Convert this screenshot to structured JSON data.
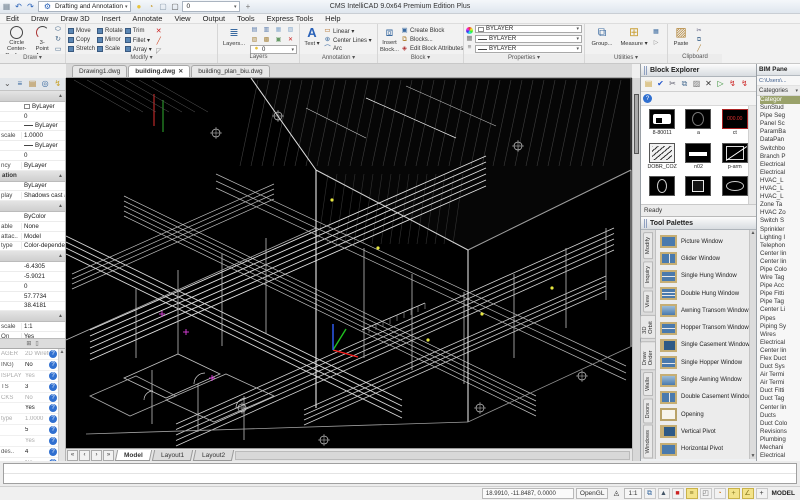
{
  "titlebar": {
    "title": "CMS IntelliCAD 9.0x64 Premium Edition Plus",
    "workspace": "Drafting and Annotation",
    "quick_layer_value": "0",
    "quick_icons": [
      {
        "name": "table-icon",
        "glyph": "▦",
        "color": "#7a8a99"
      },
      {
        "name": "undo-icon",
        "glyph": "↶",
        "color": "#2a62b8"
      },
      {
        "name": "redo-icon",
        "glyph": "↷",
        "color": "#2a62b8"
      }
    ],
    "layer_icons": [
      {
        "name": "bulb-on-icon",
        "glyph": "●",
        "color": "#e8c33a"
      },
      {
        "name": "freeze-icon",
        "glyph": "◔",
        "color": "#caa23a"
      },
      {
        "name": "lock-icon",
        "glyph": "▢",
        "color": "#8898a8"
      },
      {
        "name": "layer-color-icon",
        "glyph": "▢",
        "color": "#555555"
      }
    ]
  },
  "menus": [
    "Edit",
    "Draw",
    "Draw 3D",
    "Insert",
    "Annotate",
    "View",
    "Output",
    "Tools",
    "Express Tools",
    "Help"
  ],
  "ribbon": {
    "draw": {
      "label": "Draw ▾",
      "circle": "Circle Center-Radius ▾",
      "arc": "3-Point Arc ▾",
      "minis": [
        {
          "name": "ellipse-icon",
          "glyph": "⬭",
          "color": "#446688"
        },
        {
          "name": "revcloud-icon",
          "glyph": "↻",
          "color": "#446688"
        },
        {
          "name": "rectangle-icon",
          "glyph": "▭",
          "color": "#446688"
        }
      ]
    },
    "modify": {
      "label": "Modify ▾",
      "col1": [
        "Move",
        "Copy",
        "Stretch"
      ],
      "col2": [
        "Rotate",
        "Mirror",
        "Scale"
      ],
      "col3": [
        "Trim",
        "Fillet ▾",
        "Array ▾"
      ],
      "col4": [
        {
          "name": "erase-icon",
          "glyph": "✕",
          "color": "#cc2222"
        },
        {
          "name": "edit-icon",
          "glyph": "╱",
          "color": "#cc4422"
        },
        {
          "name": "chamfer-icon",
          "glyph": "◸",
          "color": "#888888"
        }
      ]
    },
    "layers": {
      "label": "Layers",
      "button": "Layers...",
      "layer_value": "0",
      "minis": [
        {
          "name": "layer-on-icon",
          "glyph": "▤",
          "color": "#5577aa"
        },
        {
          "name": "layer-off-icon",
          "glyph": "▥",
          "color": "#5577aa"
        },
        {
          "name": "layer-freeze-icon",
          "glyph": "▦",
          "color": "#88aacc"
        },
        {
          "name": "layer-thaw-icon",
          "glyph": "▧",
          "color": "#88aacc"
        },
        {
          "name": "layer-lock-icon",
          "glyph": "▨",
          "color": "#aa8844"
        },
        {
          "name": "layer-unlock-icon",
          "glyph": "▩",
          "color": "#aa8844"
        },
        {
          "name": "layer-match-icon",
          "glyph": "▣",
          "color": "#669966"
        },
        {
          "name": "layer-delete-icon",
          "glyph": "✕",
          "color": "#cc2222"
        }
      ]
    },
    "annotation": {
      "label": "Annotation ▾",
      "text": "Text ▾",
      "items": [
        {
          "label": "Linear ▾",
          "name": "linear-dim-icon",
          "glyph": "▭",
          "color": "#b06820"
        },
        {
          "label": "Center Lines ▾",
          "name": "centerlines-icon",
          "glyph": "⊕",
          "color": "#3a6aa0"
        },
        {
          "label": "Arc",
          "name": "arc-leader-icon",
          "glyph": "⌒",
          "color": "#3a6aa0"
        }
      ]
    },
    "block": {
      "label": "Block ▾",
      "insert": "Insert Block...",
      "items": [
        {
          "label": "Create Block",
          "name": "create-block-icon",
          "glyph": "▣",
          "color": "#3a6aa0"
        },
        {
          "label": "Blocks...",
          "name": "blocks-icon",
          "glyph": "⧉",
          "color": "#b08030"
        },
        {
          "label": "Edit Block Attributes",
          "name": "edit-attributes-icon",
          "glyph": "◈",
          "color": "#b03030"
        }
      ]
    },
    "properties": {
      "label": "Properties ▾",
      "dropdowns": [
        "BYLAYER",
        "BYLAYER",
        "BYLAYER"
      ]
    },
    "utilities": {
      "label": "Utilities ▾",
      "group": "Group...",
      "measure": "Measure ▾"
    },
    "clipboard": {
      "label": "Clipboard",
      "paste": "Paste",
      "minis": [
        {
          "name": "cut-icon",
          "glyph": "✂",
          "color": "#555577"
        },
        {
          "name": "copy-icon",
          "glyph": "⧉",
          "color": "#557799"
        },
        {
          "name": "matchprops-icon",
          "glyph": "╱",
          "color": "#aa7722"
        }
      ]
    }
  },
  "doc_tabs": [
    {
      "label": "Drawing1.dwg",
      "active": false
    },
    {
      "label": "building.dwg",
      "active": true
    },
    {
      "label": "building_plan_biu.dwg",
      "active": false
    }
  ],
  "properties_panel": {
    "toolbar_icons": [
      {
        "name": "selection-dropdown-icon",
        "glyph": "⌄",
        "color": "#555555"
      },
      {
        "name": "quick-select-icon",
        "glyph": "≡",
        "color": "#3a6aa0"
      },
      {
        "name": "object-icon",
        "glyph": "▤",
        "color": "#b08030"
      },
      {
        "name": "search-icon",
        "glyph": "◎",
        "color": "#3a6aa0"
      },
      {
        "name": "flash-icon",
        "glyph": "↯",
        "color": "#c9a227"
      }
    ],
    "rows": [
      {
        "kind": "header",
        "label": "",
        "value": ""
      },
      {
        "kind": "row",
        "label": "",
        "value": "ByLayer",
        "icon": "swatch"
      },
      {
        "kind": "row",
        "label": "",
        "value": "0"
      },
      {
        "kind": "row",
        "label": "",
        "value": "ByLayer",
        "icon": "hline"
      },
      {
        "kind": "row",
        "label": "scale",
        "value": "1.0000"
      },
      {
        "kind": "row",
        "label": "",
        "value": "ByLayer",
        "icon": "hline"
      },
      {
        "kind": "row",
        "label": "",
        "value": "0"
      },
      {
        "kind": "row",
        "label": "ncy",
        "value": "ByLayer"
      },
      {
        "kind": "header",
        "label": "ation",
        "value": ""
      },
      {
        "kind": "row",
        "label": "",
        "value": "ByLayer"
      },
      {
        "kind": "row",
        "label": "play",
        "value": "Shadows cast a.."
      },
      {
        "kind": "header",
        "label": "",
        "value": ""
      },
      {
        "kind": "row",
        "label": "",
        "value": "ByColor"
      },
      {
        "kind": "row",
        "label": "able",
        "value": "None"
      },
      {
        "kind": "row",
        "label": "attac..",
        "value": "Model"
      },
      {
        "kind": "row",
        "label": "type",
        "value": "Color-dependen..."
      },
      {
        "kind": "header",
        "label": "",
        "value": ""
      },
      {
        "kind": "row",
        "label": "",
        "value": "-6.4305"
      },
      {
        "kind": "row",
        "label": "",
        "value": "-5.9021"
      },
      {
        "kind": "row",
        "label": "",
        "value": "0"
      },
      {
        "kind": "row",
        "label": "",
        "value": "57.7734"
      },
      {
        "kind": "row",
        "label": "",
        "value": "38.4181"
      },
      {
        "kind": "header",
        "label": "",
        "value": ""
      },
      {
        "kind": "row",
        "label": "scale",
        "value": "1:1"
      },
      {
        "kind": "row",
        "label": "On",
        "value": "Yes"
      }
    ]
  },
  "sysvar_panel": {
    "rows": [
      {
        "label": "AGER",
        "value": "2D Wirefr",
        "dim": true
      },
      {
        "label": "ING)",
        "value": "No",
        "dim": false
      },
      {
        "label": "ISPLAY",
        "value": "Yes",
        "dim": true
      },
      {
        "label": "TS",
        "value": "3",
        "dim": false
      },
      {
        "label": "CKS",
        "value": "No",
        "dim": true
      },
      {
        "label": "",
        "value": "Yes",
        "dim": false
      },
      {
        "label": "type",
        "value": "1.0000",
        "dim": true
      },
      {
        "label": "",
        "value": "5",
        "dim": false
      },
      {
        "label": "",
        "value": "Yes",
        "dim": true
      },
      {
        "label": "des..",
        "value": "4",
        "dim": false
      },
      {
        "label": "",
        "value": "No",
        "dim": true
      },
      {
        "label": "",
        "value": "",
        "dim": true
      }
    ]
  },
  "block_explorer": {
    "title": "Block Explorer",
    "status": "Ready",
    "toolbar_icons": [
      {
        "name": "new-block-icon",
        "glyph": "▤",
        "color": "#caa23a"
      },
      {
        "name": "confirm-icon",
        "glyph": "✔",
        "color": "#2255cc"
      },
      {
        "name": "cut-icon",
        "glyph": "✂",
        "color": "#556"
      },
      {
        "name": "copy-icon",
        "glyph": "⧉",
        "color": "#557799"
      },
      {
        "name": "paste-icon",
        "glyph": "▨",
        "color": "#777777"
      },
      {
        "name": "delete-icon",
        "glyph": "✕",
        "color": "#333333"
      },
      {
        "name": "new-drawing-icon",
        "glyph": "▷",
        "color": "#2a8a2a"
      },
      {
        "name": "sync-icon",
        "glyph": "↯",
        "color": "#cc2222"
      },
      {
        "name": "regen-icon",
        "glyph": "↯",
        "color": "#cc2222"
      }
    ],
    "help_icon": "?",
    "blocks": [
      {
        "name": "8-80011",
        "variant": "plate",
        "thumb_text": ""
      },
      {
        "name": "a",
        "variant": "circle",
        "thumb_text": ""
      },
      {
        "name": "ct",
        "variant": "ct",
        "thumb_text": "000.00"
      },
      {
        "name": "DOBR_COZ",
        "variant": "sketch",
        "thumb_text": ""
      },
      {
        "name": "n02",
        "variant": "hbar",
        "thumb_text": ""
      },
      {
        "name": "p-arm",
        "variant": "diag",
        "thumb_text": ""
      },
      {
        "name": "",
        "variant": "oval",
        "thumb_text": ""
      },
      {
        "name": "",
        "variant": "square",
        "thumb_text": ""
      },
      {
        "name": "",
        "variant": "ellipse",
        "thumb_text": ""
      }
    ]
  },
  "tool_palettes": {
    "title": "Tool Palettes",
    "tabs": [
      "Modify",
      "Inquiry",
      "View",
      "3D Orbit",
      "Draw Order",
      "Walls",
      "Doors",
      "Windows"
    ],
    "items": [
      {
        "label": "Picture Window",
        "variant": "plain"
      },
      {
        "label": "Glider Window",
        "variant": "vsplit"
      },
      {
        "label": "Single Hung Window",
        "variant": "hsplit"
      },
      {
        "label": "Double Hung Window",
        "variant": "hsplit2"
      },
      {
        "label": "Awning Transom Window",
        "variant": "light"
      },
      {
        "label": "Hopper Transom Window",
        "variant": "hsplit"
      },
      {
        "label": "Single Casement Window",
        "variant": "door"
      },
      {
        "label": "Single Hopper Window",
        "variant": "hsplit"
      },
      {
        "label": "Single Awning Window",
        "variant": "light"
      },
      {
        "label": "Double Casement Window",
        "variant": "vsplit"
      },
      {
        "label": "Opening",
        "variant": "opening"
      },
      {
        "label": "Vertical Pivot",
        "variant": "door"
      },
      {
        "label": "Horizontal Pivot",
        "variant": "plain"
      }
    ]
  },
  "bim_pane": {
    "title": "BIM Pane",
    "path": "C:\\Users\\...",
    "categories_label": "Categories",
    "items": [
      {
        "label": "Categor",
        "active": true
      },
      {
        "label": "SunStud",
        "active": false
      },
      {
        "label": "Pipe Seg",
        "active": false
      },
      {
        "label": "Panel Sc",
        "active": false
      },
      {
        "label": "ParamBa",
        "active": false
      },
      {
        "label": "DataPan",
        "active": false
      },
      {
        "label": "Switchbo",
        "active": false
      },
      {
        "label": "Branch P",
        "active": false
      },
      {
        "label": "Electrical",
        "active": false
      },
      {
        "label": "Electrical",
        "active": false
      },
      {
        "label": "HVAC_L",
        "active": false
      },
      {
        "label": "HVAC_L",
        "active": false
      },
      {
        "label": "HVAC_L",
        "active": false
      },
      {
        "label": "Zone Ta",
        "active": false
      },
      {
        "label": "HVAC Zo",
        "active": false
      },
      {
        "label": "Switch S",
        "active": false
      },
      {
        "label": "Sprinkler",
        "active": false
      },
      {
        "label": "Lighting I",
        "active": false
      },
      {
        "label": "Telephon",
        "active": false
      },
      {
        "label": "Center lin",
        "active": false
      },
      {
        "label": "Center lin",
        "active": false
      },
      {
        "label": "Pipe Colo",
        "active": false
      },
      {
        "label": "Wire Tag",
        "active": false
      },
      {
        "label": "Pipe Acc",
        "active": false
      },
      {
        "label": "Pipe Fitti",
        "active": false
      },
      {
        "label": "Pipe Tag",
        "active": false
      },
      {
        "label": "Center Li",
        "active": false
      },
      {
        "label": "Pipes",
        "active": false
      },
      {
        "label": "Piping Sy",
        "active": false
      },
      {
        "label": "Wires",
        "active": false
      },
      {
        "label": "Electrical",
        "active": false
      },
      {
        "label": "Center lin",
        "active": false
      },
      {
        "label": "Flex Duct",
        "active": false
      },
      {
        "label": "Duct Sys",
        "active": false
      },
      {
        "label": "Air Termi",
        "active": false
      },
      {
        "label": "Air Termi",
        "active": false
      },
      {
        "label": "Duct Fitti",
        "active": false
      },
      {
        "label": "Duct Tag",
        "active": false
      },
      {
        "label": "Center lin",
        "active": false
      },
      {
        "label": "Ducts",
        "active": false
      },
      {
        "label": "Duct Colo",
        "active": false
      },
      {
        "label": "Revisions",
        "active": false
      },
      {
        "label": "Plumbing",
        "active": false
      },
      {
        "label": "Mechani",
        "active": false
      },
      {
        "label": "Electrical",
        "active": false
      }
    ]
  },
  "model_tabs": {
    "nav": [
      "«",
      "‹",
      "›",
      "»"
    ],
    "tabs": [
      {
        "label": "Model",
        "active": true
      },
      {
        "label": "Layout1",
        "active": false
      },
      {
        "label": "Layout2",
        "active": false
      }
    ]
  },
  "statusbar": {
    "coords": "18.9910, -11.8487, 0.0000",
    "renderer": "OpenGL",
    "ruler_glyph": "◬",
    "scale": "1:1",
    "mode": "MODEL",
    "icons": [
      {
        "name": "viewport-icon",
        "glyph": "⧉",
        "color": "#3a6aa0",
        "on": false
      },
      {
        "name": "annotation-monitor-icon",
        "glyph": "▲",
        "color": "#445566",
        "on": false
      },
      {
        "name": "record-macro-icon",
        "glyph": "■",
        "color": "#cc2222",
        "on": false
      },
      {
        "name": "lineweight-icon",
        "glyph": "≡",
        "color": "#8a7a22",
        "on": true
      },
      {
        "name": "ucs-icon",
        "glyph": "◰",
        "color": "#666666",
        "on": false
      },
      {
        "name": "time-icon",
        "glyph": "◔",
        "color": "#d07820",
        "on": false
      },
      {
        "name": "snap-cross-icon",
        "glyph": "+",
        "color": "#8a7a22",
        "on": true
      },
      {
        "name": "angle-snap-icon",
        "glyph": "∠",
        "color": "#8a7a22",
        "on": true
      },
      {
        "name": "crosshair-icon",
        "glyph": "+",
        "color": "#333333",
        "on": false
      }
    ]
  },
  "ucs_colors": {
    "x_axis": "#ff2020",
    "y_axis": "#20c020",
    "z_axis": "#3060ff"
  }
}
